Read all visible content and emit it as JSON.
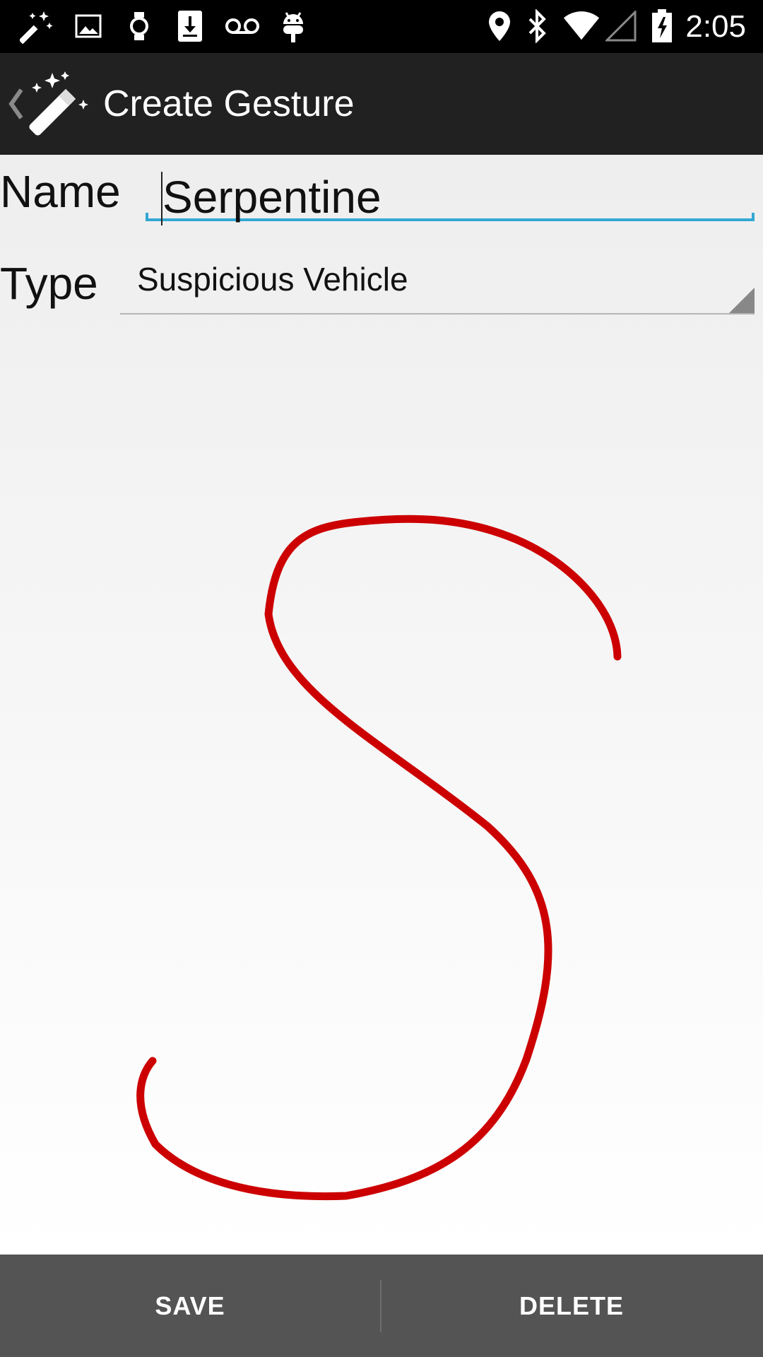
{
  "status_bar": {
    "left_icons": [
      "magic-wand-icon",
      "image-icon",
      "watch-icon",
      "download-icon",
      "voicemail-icon",
      "android-icon"
    ],
    "right_icons": [
      "location-icon",
      "bluetooth-icon",
      "wifi-icon",
      "cell-signal-icon",
      "battery-charging-icon"
    ],
    "time": "2:05"
  },
  "action_bar": {
    "title": "Create Gesture",
    "icon": "magic-wand-icon"
  },
  "form": {
    "name_label": "Name",
    "name_value": "Serpentine",
    "type_label": "Type",
    "type_value": "Suspicious Vehicle"
  },
  "gesture": {
    "stroke_color": "#cc0000",
    "shape": "S"
  },
  "bottom_bar": {
    "save_label": "SAVE",
    "delete_label": "DELETE"
  },
  "colors": {
    "accent": "#33a7d3",
    "action_bar": "#212121",
    "bottom_bar": "#545454"
  }
}
